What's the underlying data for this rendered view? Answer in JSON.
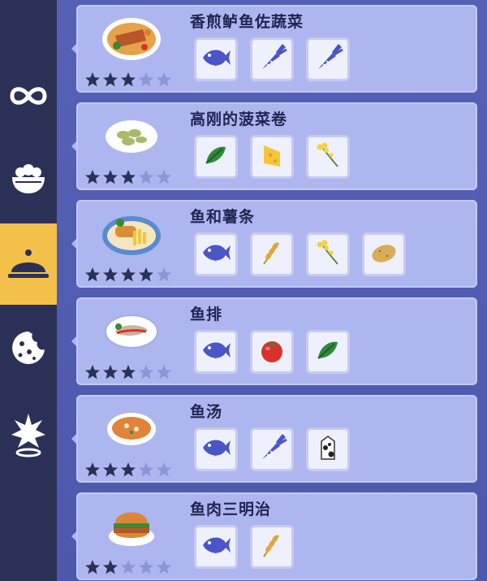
{
  "sidebar": {
    "items": [
      {
        "icon": "infinity-icon",
        "active": false
      },
      {
        "icon": "bowl-icon",
        "active": false
      },
      {
        "icon": "cloche-icon",
        "active": true
      },
      {
        "icon": "cookie-icon",
        "active": false
      },
      {
        "icon": "star-burst-icon",
        "active": false
      }
    ]
  },
  "recipes": [
    {
      "name": "香煎鲈鱼佐蔬菜",
      "rating": 3,
      "max_rating": 5,
      "ingredients": [
        "fish",
        "carrot",
        "carrot"
      ]
    },
    {
      "name": "高刚的菠菜卷",
      "rating": 3,
      "max_rating": 5,
      "ingredients": [
        "spinach",
        "cheese",
        "rapeseed-flower"
      ]
    },
    {
      "name": "鱼和薯条",
      "rating": 4,
      "max_rating": 5,
      "ingredients": [
        "fish",
        "wheat",
        "rapeseed-flower",
        "potato"
      ]
    },
    {
      "name": "鱼排",
      "rating": 3,
      "max_rating": 5,
      "ingredients": [
        "fish",
        "tomato",
        "spinach"
      ]
    },
    {
      "name": "鱼汤",
      "rating": 3,
      "max_rating": 5,
      "ingredients": [
        "fish",
        "carrot",
        "milk"
      ]
    },
    {
      "name": "鱼肉三明治",
      "rating": 2,
      "max_rating": 5,
      "ingredients": [
        "fish",
        "wheat"
      ]
    }
  ],
  "colors": {
    "accent": "#f3c04a",
    "card": "#aeb6ef",
    "star_on": "#2b3156",
    "star_off": "#8c95d6",
    "fish": "#4a55c8"
  }
}
